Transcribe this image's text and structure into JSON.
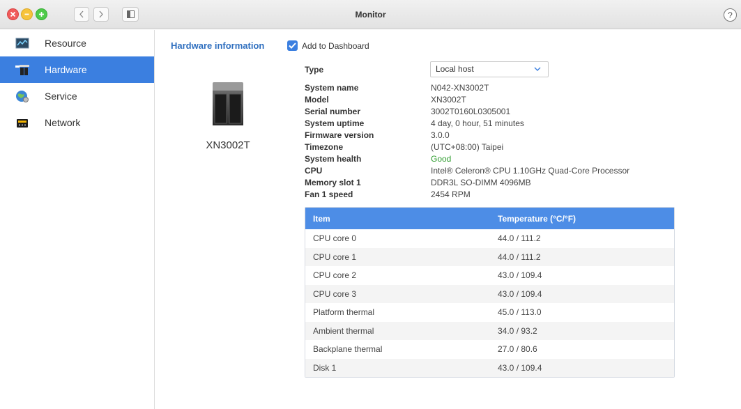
{
  "window": {
    "title": "Monitor",
    "help": "?"
  },
  "sidebar": {
    "items": [
      {
        "label": "Resource"
      },
      {
        "label": "Hardware"
      },
      {
        "label": "Service"
      },
      {
        "label": "Network"
      }
    ],
    "active_index": 1
  },
  "main": {
    "section_title": "Hardware information",
    "add_to_dashboard": {
      "label": "Add to Dashboard",
      "checked": true
    },
    "device_name": "XN3002T",
    "info": [
      {
        "label": "Type",
        "value": "Local host"
      },
      {
        "label": "System name",
        "value": "N042-XN3002T"
      },
      {
        "label": "Model",
        "value": "XN3002T"
      },
      {
        "label": "Serial number",
        "value": "3002T0160L0305001"
      },
      {
        "label": "System uptime",
        "value": "4 day, 0 hour, 51 minutes"
      },
      {
        "label": "Firmware version",
        "value": "3.0.0"
      },
      {
        "label": "Timezone",
        "value": "(UTC+08:00) Taipei"
      },
      {
        "label": "System health",
        "value": "Good"
      },
      {
        "label": "CPU",
        "value": "Intel® Celeron® CPU 1.10GHz Quad-Core Processor"
      },
      {
        "label": "Memory slot 1",
        "value": "DDR3L SO-DIMM 4096MB"
      },
      {
        "label": "Fan 1 speed",
        "value": "2454 RPM"
      }
    ],
    "table": {
      "headers": [
        "Item",
        "Temperature (°C/°F)"
      ],
      "rows": [
        [
          "CPU core 0",
          "44.0 / 111.2"
        ],
        [
          "CPU core 1",
          "44.0 / 111.2"
        ],
        [
          "CPU core 2",
          "43.0 / 109.4"
        ],
        [
          "CPU core 3",
          "43.0 / 109.4"
        ],
        [
          "Platform thermal",
          "45.0 / 113.0"
        ],
        [
          "Ambient thermal",
          "34.0 / 93.2"
        ],
        [
          "Backplane thermal",
          "27.0 / 80.6"
        ],
        [
          "Disk 1",
          "43.0 / 109.4"
        ]
      ]
    }
  },
  "colors": {
    "accent": "#3b7fe0",
    "table_header": "#4d8de6",
    "section_title": "#2f6fbf",
    "good": "#2e9c2e"
  },
  "icons": [
    "close-icon",
    "minimize-icon",
    "maximize-icon",
    "chevron-left-icon",
    "chevron-right-icon",
    "sidebar-icon",
    "help-icon",
    "resource-icon",
    "hardware-icon",
    "service-icon",
    "network-icon",
    "check-icon",
    "chevron-down-icon",
    "nas-device-icon"
  ]
}
